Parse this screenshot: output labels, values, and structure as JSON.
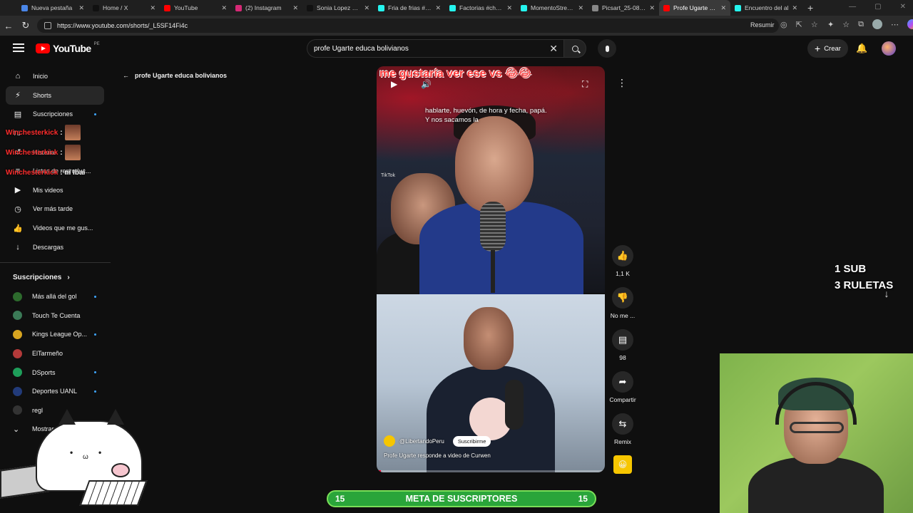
{
  "browser": {
    "tabs": [
      {
        "label": "Nueva pestaña",
        "color": "#4a86e8"
      },
      {
        "label": "Home / X",
        "color": "#111111"
      },
      {
        "label": "YouTube",
        "color": "#ff0000"
      },
      {
        "label": "(2) Instagram",
        "color": "#d62976"
      },
      {
        "label": "Sonia Lopez on X",
        "color": "#111111"
      },
      {
        "label": "Fria de frias #chi",
        "color": "#25f4ee"
      },
      {
        "label": "Factorias #chale",
        "color": "#25f4ee"
      },
      {
        "label": "MomentoStream",
        "color": "#25f4ee"
      },
      {
        "label": "Picsart_25-08-27",
        "color": "#888888"
      },
      {
        "label": "Profe Ugarte res",
        "color": "#ff0000"
      },
      {
        "label": "Encuentro del al",
        "color": "#25f4ee"
      }
    ],
    "active_tab_index": 9,
    "url": "https://www.youtube.com/shorts/_L5SF14Fi4c",
    "resumir_label": "Resumir"
  },
  "header": {
    "logo_text": "YouTube",
    "logo_country": "PE",
    "search_value": "profe Ugarte educa bolivianos",
    "create_label": "Crear"
  },
  "sidebar": {
    "items": [
      {
        "label": "Inicio",
        "icon": "home-icon",
        "glyph": "⌂"
      },
      {
        "label": "Shorts",
        "icon": "shorts-icon",
        "glyph": "⚡"
      },
      {
        "label": "Suscripciones",
        "icon": "subscriptions-icon",
        "glyph": "▤"
      }
    ],
    "you_label": "Tú",
    "you_items": [
      {
        "label": "Historial",
        "icon": "history-icon",
        "glyph": "↺"
      },
      {
        "label": "Listas de reproduc...",
        "icon": "playlist-icon",
        "glyph": "≡"
      },
      {
        "label": "Mis videos",
        "icon": "my-videos-icon",
        "glyph": "▶"
      },
      {
        "label": "Ver más tarde",
        "icon": "watch-later-icon",
        "glyph": "◷"
      },
      {
        "label": "Videos que me gus...",
        "icon": "liked-icon",
        "glyph": "👍"
      },
      {
        "label": "Descargas",
        "icon": "download-icon",
        "glyph": "↓"
      }
    ],
    "subs_heading": "Suscripciones",
    "subs": [
      {
        "label": "Más allá del gol",
        "color": "#2d6b2d",
        "dot": true
      },
      {
        "label": "Touch Te Cuenta",
        "color": "#3b7a57",
        "dot": false
      },
      {
        "label": "Kings League Op...",
        "color": "#d8a520",
        "dot": true
      },
      {
        "label": "ElTarmeño",
        "color": "#b33a3a",
        "dot": false
      },
      {
        "label": "DSports",
        "color": "#1e9e5a",
        "dot": true
      },
      {
        "label": "Deportes UANL",
        "color": "#223b7a",
        "dot": true
      },
      {
        "label": "regl",
        "color": "#333333",
        "dot": false
      },
      {
        "label": "Mostrar más",
        "color": "#000000",
        "dot": false
      }
    ]
  },
  "chat_overlay": [
    {
      "name": "Winchesterkick",
      "msg": ":"
    },
    {
      "name": "Winchesterkick",
      "msg": ":"
    },
    {
      "name": "Winchesterkick",
      "msg": ": ni Ibai"
    }
  ],
  "back_link": "profe Ugarte educa bolivianos",
  "video": {
    "caption": "me gustaría ver ese vs 😂😂",
    "subtitle_line1": "hablarte, huevón, de hora y fecha, papá.",
    "subtitle_line2": "Y nos sacamos la",
    "tiktok_label": "TikTok",
    "channel": "@LibertandoPeru",
    "subscribe_label": "Suscribirme",
    "title": "Profe Ugarte responde a video de Curwen",
    "progress": 0.02
  },
  "actions": [
    {
      "label": "1,1 K",
      "icon": "like-icon",
      "glyph": "👍"
    },
    {
      "label": "No me ...",
      "icon": "dislike-icon",
      "glyph": "👎"
    },
    {
      "label": "98",
      "icon": "comments-icon",
      "glyph": "▤"
    },
    {
      "label": "Compartir",
      "icon": "share-icon",
      "glyph": "➦"
    },
    {
      "label": "Remix",
      "icon": "remix-icon",
      "glyph": "⇆"
    }
  ],
  "stream": {
    "goal_line1": "1 SUB",
    "goal_line2": "3 RULETAS",
    "goal_bar_left": "15",
    "goal_bar_label": "META DE SUSCRIPTORES",
    "goal_bar_right": "15"
  }
}
